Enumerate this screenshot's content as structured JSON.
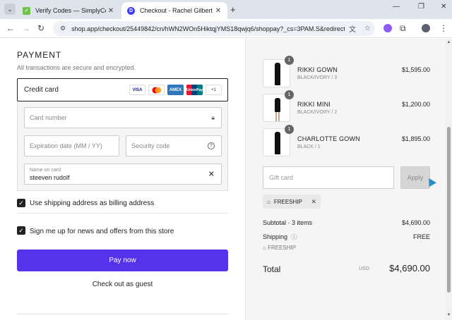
{
  "tabs": [
    {
      "title": "Verify Codes — SimplyCodes",
      "fav_icon": "simplycodes-icon",
      "fav_color": "#6cc24a"
    },
    {
      "title": "Checkout - Rachel Gilbert US",
      "fav_icon": "d-logo-icon",
      "fav_color": "#3f3df5"
    }
  ],
  "address_bar": {
    "url": "shop.app/checkout/25449842/cn/hWN2WOn5HiktqjYMS18qwjq6/shoppay?_cs=3PAM.S&redirect..."
  },
  "payment": {
    "title": "PAYMENT",
    "subtitle": "All transactions are secure and encrypted.",
    "method_label": "Credit card",
    "card_brands": [
      "VISA",
      "",
      "AMEX",
      "UnionPay",
      "+1"
    ],
    "card_number_placeholder": "Card number",
    "expiration_placeholder": "Expiration date (MM / YY)",
    "security_code_placeholder": "Security code",
    "name_label": "Name on card",
    "name_value": "steeven rudolf",
    "billing_checkbox_label": "Use shipping address as billing address",
    "news_checkbox_label": "Sign me up for news and offers from this store",
    "pay_button": "Pay now",
    "guest_link": "Check out as guest"
  },
  "summary": {
    "items": [
      {
        "name": "RIKKI GOWN",
        "variant": "BLACK/IVORY / 3",
        "price": "$1,595.00",
        "qty": "1"
      },
      {
        "name": "RIKKI MINI",
        "variant": "BLACK/IVORY / 2",
        "price": "$1,200.00",
        "qty": "1"
      },
      {
        "name": "CHARLOTTE GOWN",
        "variant": "BLACK / 1",
        "price": "$1,895.00",
        "qty": "1"
      }
    ],
    "gift_placeholder": "Gift card",
    "apply_button": "Apply",
    "discount_code": "FREESHIP",
    "subtotal_label": "Subtotal · 3 items",
    "subtotal_value": "$4,690.00",
    "shipping_label": "Shipping",
    "shipping_value": "FREE",
    "shipping_discount": "FREESHIP",
    "total_label": "Total",
    "currency": "USD",
    "total_value": "$4,690.00"
  },
  "colors": {
    "accent": "#5433eb",
    "summary_bg": "#f5f5f5"
  }
}
